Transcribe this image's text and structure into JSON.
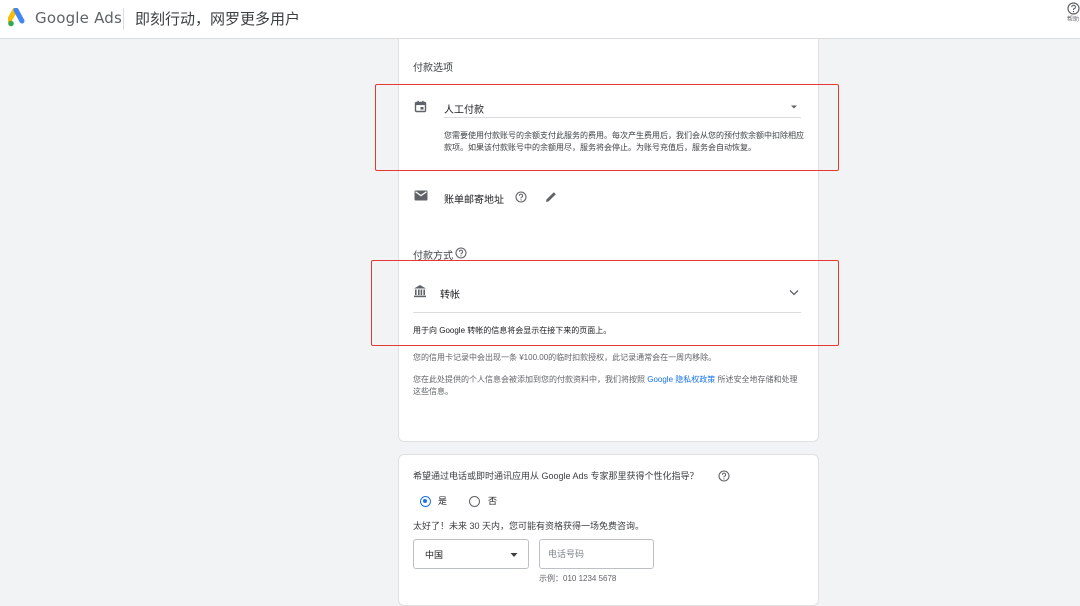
{
  "header": {
    "brand": "Google Ads",
    "tagline": "即刻行动，网罗更多用户",
    "help_label": "帮助"
  },
  "payment": {
    "section_title": "付款选项",
    "method_selected": "人工付款",
    "method_description": "您需要使用付款账号的余额支付此服务的费用。每次产生费用后，我们会从您的预付款余额中扣除相应款项。如果该付款账号中的余额用尽，服务将会停止。为账号充值后，服务会自动恢复。",
    "billing_address_label": "账单邮寄地址",
    "pay_type_title": "付款方式",
    "pay_type_selected": "转帐",
    "transfer_note": "用于向 Google 转帐的信息将会显示在接下来的页面上。",
    "temp_charge_note": "您的信用卡记录中会出现一条 ¥100.00的临时扣款授权，此记录通常会在一周内移除。",
    "privacy_note_prefix": "您在此处提供的个人信息会被添加到您的付款资料中，我们将按照",
    "privacy_link": "Google 隐私权政策",
    "privacy_note_suffix": "所述安全地存储和处理这些信息。"
  },
  "consult": {
    "question": "希望通过电话或即时通讯应用从 Google Ads 专家那里获得个性化指导？",
    "option_yes": "是",
    "option_no": "否",
    "selected": "是",
    "promo": "太好了！未来 30 天内，您可能有资格获得一场免费咨询。",
    "country_selected": "中国",
    "phone_placeholder": "电话号码",
    "phone_example": "示例：010 1234 5678"
  },
  "colors": {
    "highlight": "#e53935",
    "accent": "#1a73e8"
  }
}
